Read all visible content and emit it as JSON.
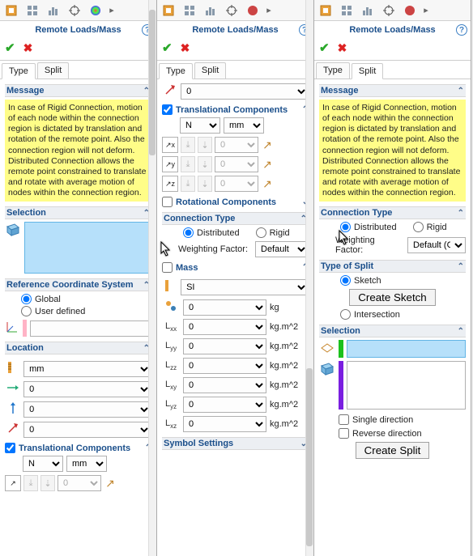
{
  "shared": {
    "title": "Remote Loads/Mass",
    "tabs": {
      "type": "Type",
      "split": "Split"
    },
    "message_header": "Message",
    "message_text": "In case of Rigid Connection, motion of each node within the connection region is dictated by translation and rotation of the remote point. Also the connection region will not deform. Distributed Connection allows the remote point constrained to translate and rotate with average motion of nodes within the connection region.",
    "selection_header": "Selection",
    "conn_type_header": "Connection Type",
    "conn_distributed": "Distributed",
    "conn_rigid": "Rigid",
    "weighting_label": "Weighting Factor:",
    "weighting_value": "Default",
    "chev_down": "⌄",
    "chev_up": "⌃"
  },
  "p1": {
    "refcoord_header": "Reference Coordinate System",
    "rc_global": "Global",
    "rc_user": "User defined",
    "location_header": "Location",
    "loc_unit": "mm",
    "loc_values": [
      "0",
      "0",
      "0"
    ],
    "trans_header": "Translational Components",
    "tc_units": {
      "force": "N",
      "len": "mm"
    },
    "tc_value": "0"
  },
  "p2": {
    "top_val": "0",
    "trans_header": "Translational Components",
    "tc_units": {
      "force": "N",
      "len": "mm"
    },
    "tc_value": "0",
    "rot_header": "Rotational Components",
    "weighting_value": "Default",
    "mass_header": "Mass",
    "mass_unit_system": "SI",
    "mass_val": "0",
    "mass_unit": "kg",
    "mi_unit": "kg.m^2",
    "mi_labels": [
      "Lxx",
      "Lyy",
      "Lzz",
      "Lxy",
      "Lyz",
      "Lxz"
    ],
    "mi_values": [
      "0",
      "0",
      "0",
      "0",
      "0",
      "0"
    ],
    "symbol_header": "Symbol Settings"
  },
  "p3": {
    "weighting_value": "Default (C",
    "split_type_header": "Type of Split",
    "split_sketch": "Sketch",
    "split_intersection": "Intersection",
    "create_sketch_btn": "Create Sketch",
    "single_dir": "Single direction",
    "reverse_dir": "Reverse direction",
    "create_split_btn": "Create Split"
  }
}
